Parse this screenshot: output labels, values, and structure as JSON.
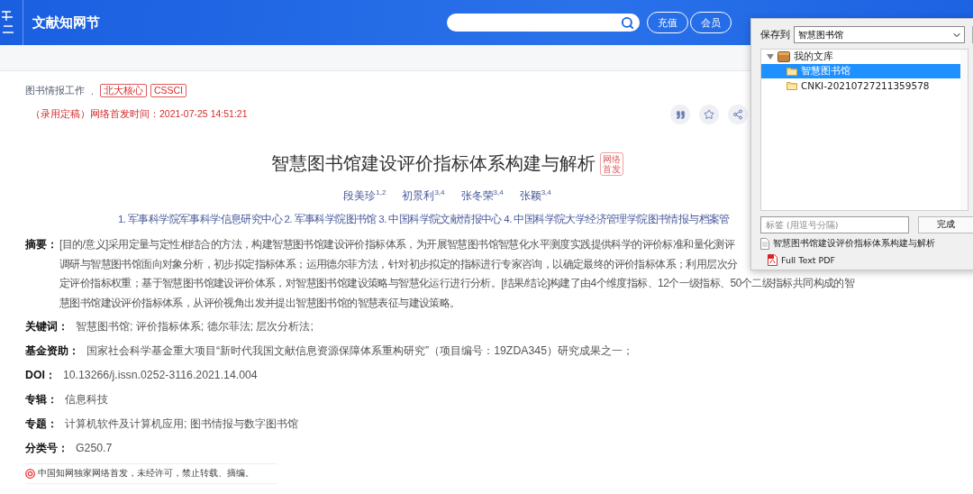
{
  "header": {
    "site_title": "文献知网节",
    "buttons": [
      "充值",
      "会员"
    ]
  },
  "meta": {
    "journal": "图书情报工作",
    "separator": ".",
    "tags": [
      "北大核心",
      "CSSCI"
    ],
    "publish_info": "（录用定稿）网络首发时间：2021-07-25 14:51:21"
  },
  "article": {
    "title": "智慧图书馆建设评价指标体系构建与解析",
    "badge_lines": [
      "网络",
      "首发"
    ],
    "authors": [
      "段美珍$^{1,2}$",
      "初景利$^{3,4}$",
      "张冬荣$^{3,4}$",
      "张颖$^{3,4}$"
    ],
    "affiliations": "1. 军事科学院军事科学信息研究中心  2. 军事科学院图书馆  3. 中国科学院文献情报中心  4. 中国科学院大学经济管理学院图书情报与档案管",
    "abstract": {
      "label": "摘要：",
      "lines": [
        "[目的/意义]采用定量与定性相结合的方法，构建智慧图书馆建设评价指标体系，为开展智慧图书馆智慧化水平测度实践提供科学的评价标准和量化测评",
        "调研与智慧图书馆面向对象分析，初步拟定指标体系；运用德尔菲方法，针对初步拟定的指标进行专家咨询，以确定最终的评价指标体系；利用层次分",
        "定评价指标权重；基于智慧图书馆建设评价体系，对智慧图书馆建设策略与智慧化运行进行分析。[结果/结论]构建了由4个维度指标、12个一级指标、50个二级指标共同构成的智",
        "慧图书馆建设评价指标体系，从评价视角出发并提出智慧图书馆的智慧表征与建设策略。"
      ]
    },
    "fields": [
      {
        "label": "关键词：",
        "value": "智慧图书馆;  评价指标体系;  德尔菲法;  层次分析法;"
      },
      {
        "label": "基金资助：",
        "value": "国家社会科学基金重大项目“新时代我国文献信息资源保障体系重构研究”（项目编号：19ZDA345）研究成果之一；"
      },
      {
        "label": "DOI：",
        "value": "10.13266/j.issn.0252-3116.2021.14.004"
      },
      {
        "label": "专辑：",
        "value": "信息科技"
      },
      {
        "label": "专题：",
        "value": "计算机软件及计算机应用; 图书情报与数字图书馆"
      },
      {
        "label": "分类号：",
        "value": "G250.7"
      }
    ],
    "notice": "中国知网独家网络首发，未经许可，禁止转载、摘编。"
  },
  "save_popup": {
    "save_to_label": "保存到",
    "folder_value": "智慧图书馆",
    "tree": [
      {
        "label": "我的文库",
        "expanded": true,
        "selected": false,
        "children": [
          {
            "label": "智慧图书馆",
            "selected": true
          },
          {
            "label": "CNKI-20210727211359578",
            "selected": false
          }
        ]
      }
    ],
    "tags_placeholder": "标签 (用逗号分隔)",
    "done_button": "完成",
    "attachments": [
      {
        "kind": "document",
        "title": "智慧图书馆建设评价指标体系构建与解析"
      },
      {
        "kind": "pdf",
        "title": "Full Text PDF"
      }
    ]
  }
}
